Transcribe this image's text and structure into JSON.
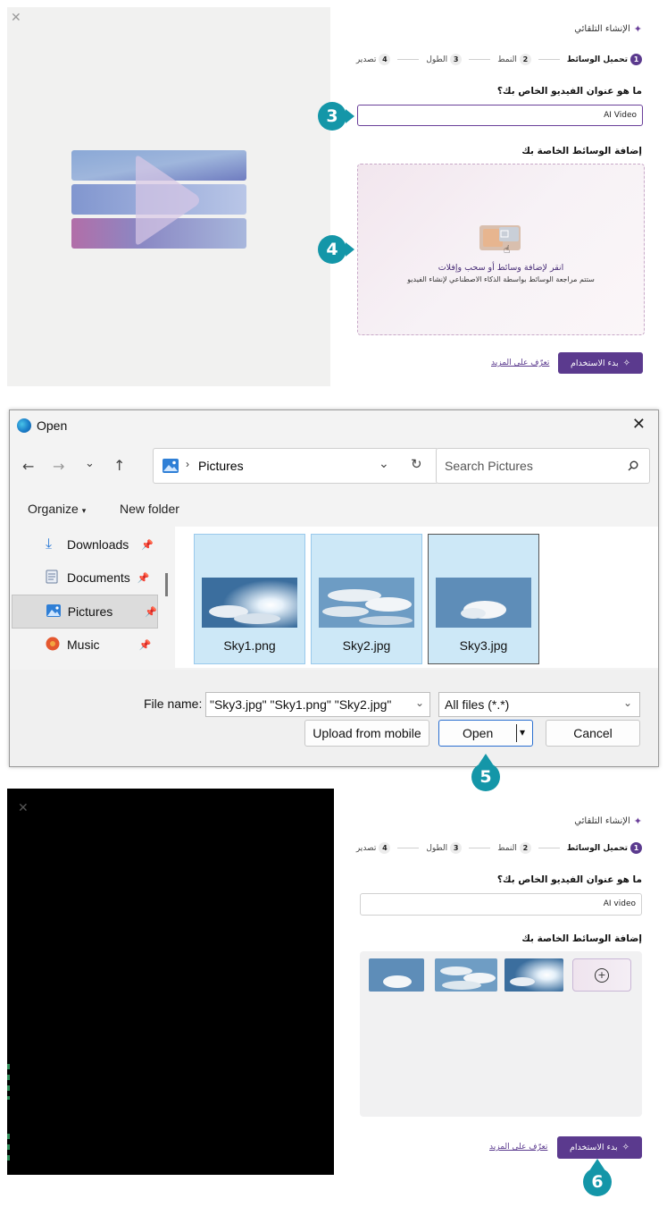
{
  "colors": {
    "accent": "#5b3a8e",
    "badge": "#1496a8",
    "dialog_selection": "#cde8f7"
  },
  "top_panel": {
    "close_icon": "close-icon",
    "title": "الإنشاء التلقائي",
    "steps": [
      {
        "num": "1",
        "label": "تحميل الوسائط",
        "active": true
      },
      {
        "num": "2",
        "label": "النمط",
        "active": false
      },
      {
        "num": "3",
        "label": "الطول",
        "active": false
      },
      {
        "num": "4",
        "label": "تصدير",
        "active": false
      }
    ],
    "question": "ما هو عنوان الفيديو الخاص بك؟",
    "title_value": "AI Video",
    "media_heading": "إضافة الوسائط الخاصة بك",
    "drop_title": "انقر لإضافة وسائط أو سحب وإفلات",
    "drop_subtitle": "ستتم مراجعة الوسائط بواسطة الذكاء الاصطناعي لإنشاء الفيديو",
    "start_button": "بدء الاستخدام",
    "learn_more": "تعرّف على المزيد",
    "badge_3": "3",
    "badge_4": "4"
  },
  "dialog": {
    "title": "Open",
    "breadcrumb": "Pictures",
    "search_placeholder": "Search Pictures",
    "organize": "Organize",
    "new_folder": "New folder",
    "sidebar": [
      {
        "label": "Downloads",
        "icon": "download-icon"
      },
      {
        "label": "Documents",
        "icon": "documents-icon"
      },
      {
        "label": "Pictures",
        "icon": "pictures-icon"
      },
      {
        "label": "Music",
        "icon": "music-icon"
      }
    ],
    "files": [
      {
        "name": "Sky1.png"
      },
      {
        "name": "Sky2.jpg"
      },
      {
        "name": "Sky3.jpg"
      }
    ],
    "file_name_label": "File name:",
    "file_name_value": "\"Sky3.jpg\" \"Sky1.png\" \"Sky2.jpg\"",
    "file_type": "All files (*.*)",
    "upload_mobile": "Upload from mobile",
    "open": "Open",
    "cancel": "Cancel",
    "badge_5": "5"
  },
  "bottom_panel": {
    "title": "الإنشاء التلقائي",
    "steps": [
      {
        "num": "1",
        "label": "تحميل الوسائط",
        "active": true
      },
      {
        "num": "2",
        "label": "النمط",
        "active": false
      },
      {
        "num": "3",
        "label": "الطول",
        "active": false
      },
      {
        "num": "4",
        "label": "تصدير",
        "active": false
      }
    ],
    "question": "ما هو عنوان الفيديو الخاص بك؟",
    "title_value": "AI video",
    "media_heading": "إضافة الوسائط الخاصة بك",
    "start_button": "بدء الاستخدام",
    "learn_more": "تعرّف على المزيد",
    "badge_6": "6"
  }
}
